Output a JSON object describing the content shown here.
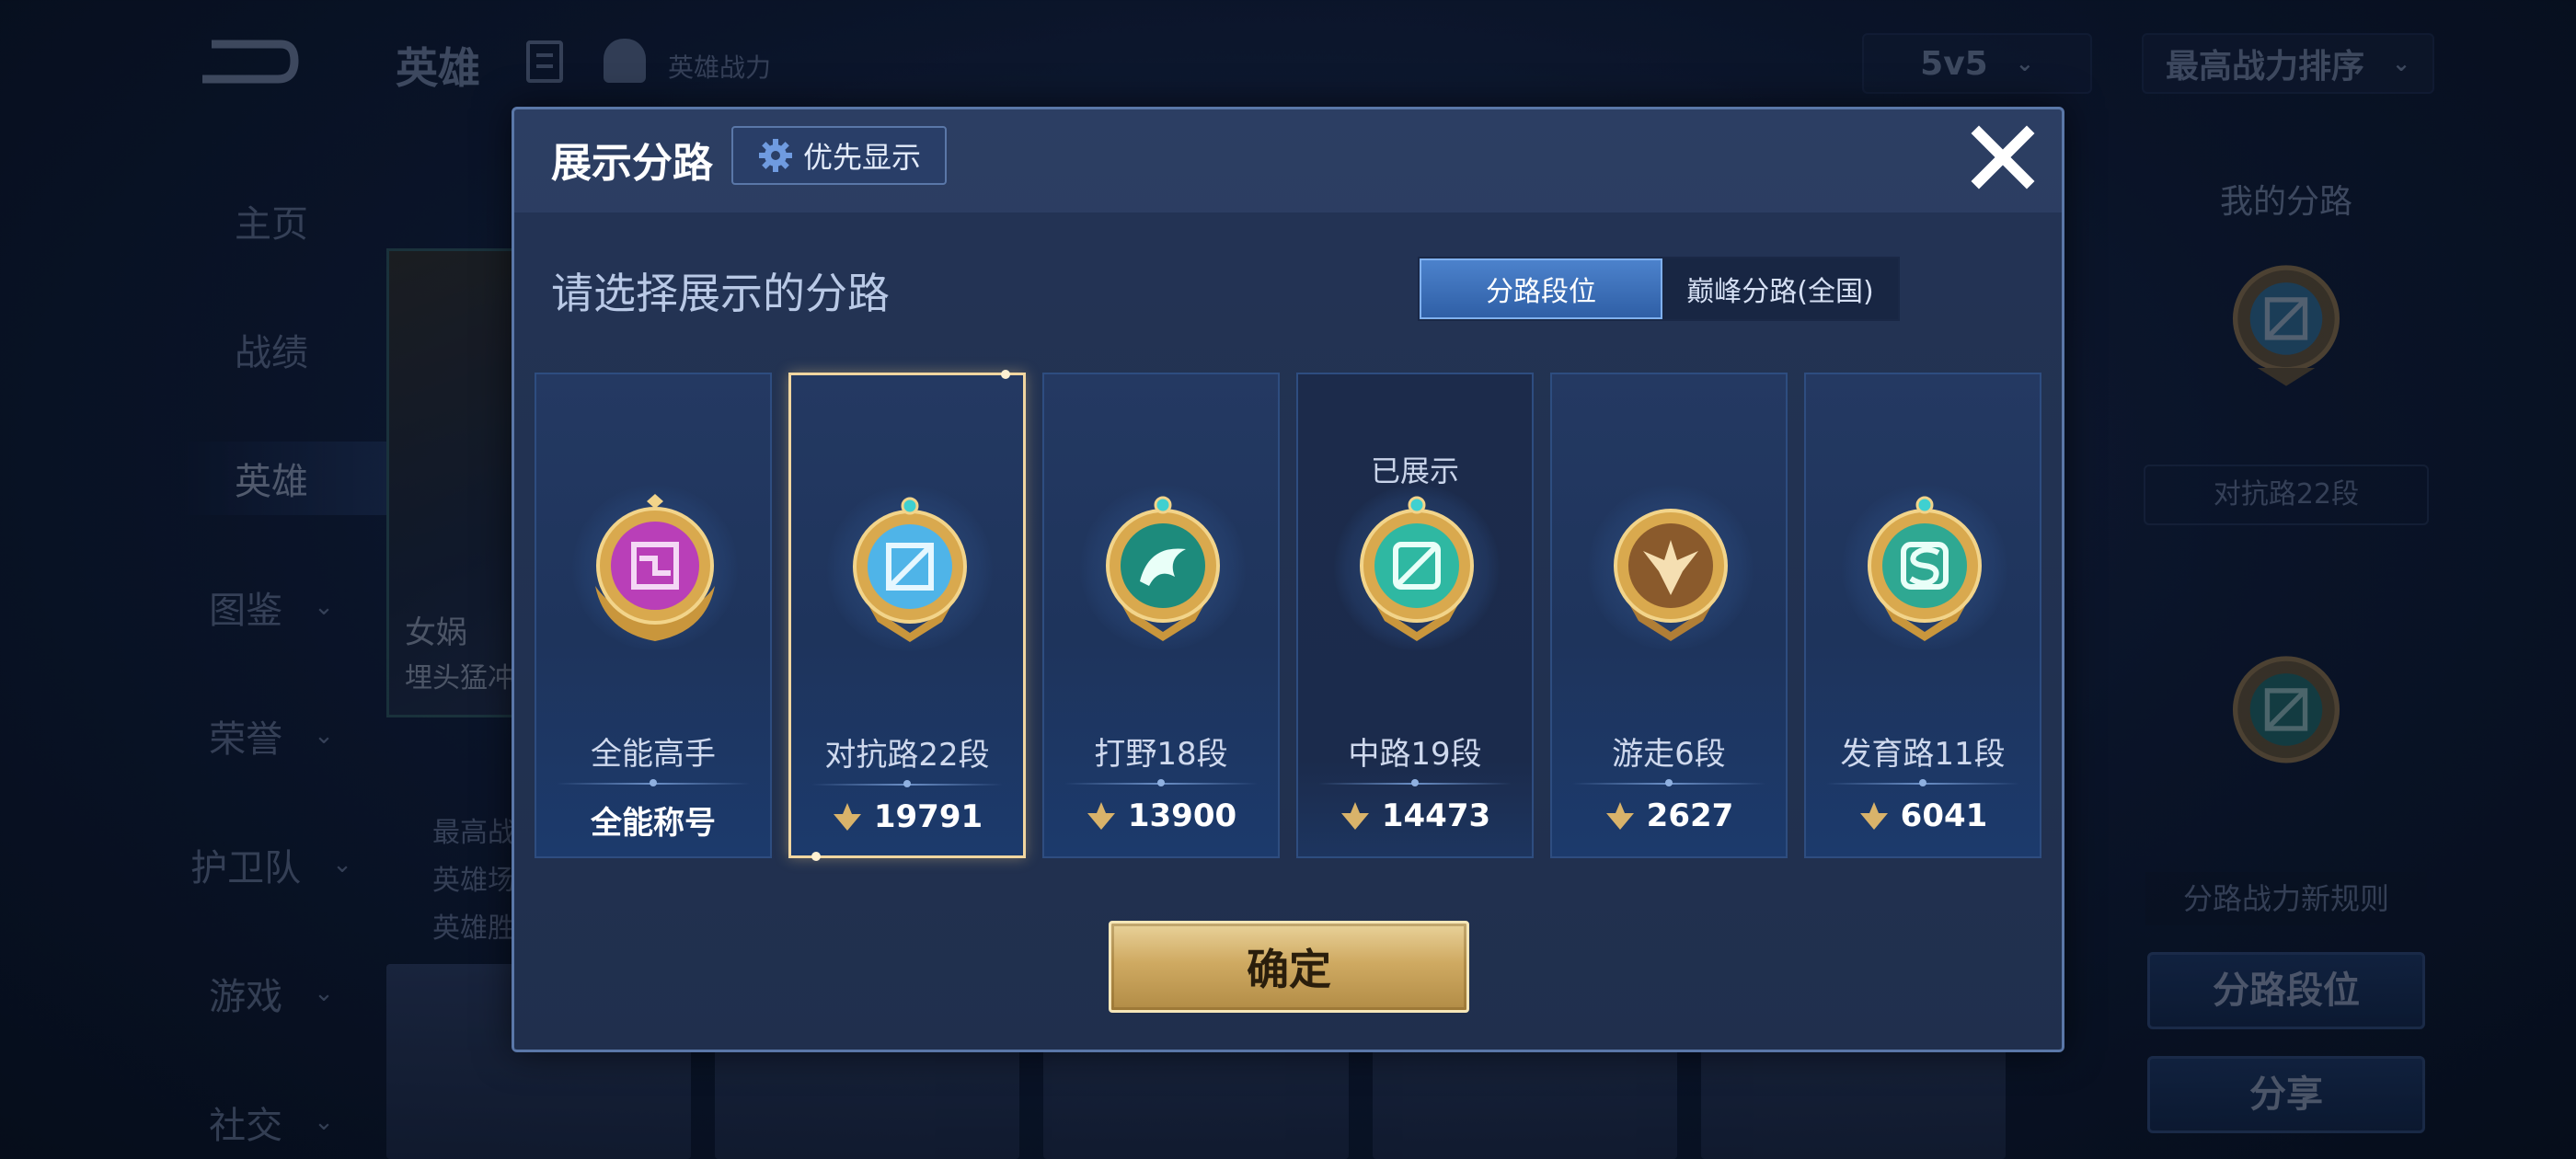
{
  "background": {
    "header": {
      "title": "英雄",
      "subtitle": "英雄战力",
      "mode_select": "5v5",
      "sort_select": "最高战力排序"
    },
    "sidebar": {
      "items": [
        {
          "label": "主页",
          "has_chevron": false,
          "active": false
        },
        {
          "label": "战绩",
          "has_chevron": false,
          "active": false
        },
        {
          "label": "英雄",
          "has_chevron": false,
          "active": true
        },
        {
          "label": "图鉴",
          "has_chevron": true,
          "active": false
        },
        {
          "label": "荣誉",
          "has_chevron": true,
          "active": false
        },
        {
          "label": "护卫队",
          "has_chevron": true,
          "active": false
        },
        {
          "label": "游戏",
          "has_chevron": true,
          "active": false
        },
        {
          "label": "社交",
          "has_chevron": true,
          "active": false
        }
      ]
    },
    "hero_card": {
      "name": "女娲",
      "epithet": "埋头猛冲",
      "stats": [
        "最高战",
        "英雄场",
        "英雄胜"
      ]
    },
    "right_panel": {
      "title": "我的分路",
      "rank": "对抗路22段",
      "rule_label": "分路战力新规则",
      "lane_rank_button": "分路段位",
      "share_button": "分享"
    }
  },
  "dialog": {
    "title": "展示分路",
    "priority_button": "优先显示",
    "subtitle": "请选择展示的分路",
    "tabs": [
      {
        "label": "分路段位",
        "active": true
      },
      {
        "label": "巅峰分路(全国)",
        "active": false
      }
    ],
    "lanes": [
      {
        "id": "all",
        "rank": "全能高手",
        "footer_label": "全能称号",
        "power": null,
        "shown": false,
        "selected": false,
        "medal_color": "#b93fb8",
        "icon": "all-round-medal-icon"
      },
      {
        "id": "clash",
        "rank": "对抗路22段",
        "power": "19791",
        "shown": false,
        "selected": true,
        "medal_color": "#4fb4e8",
        "icon": "clash-lane-medal-icon"
      },
      {
        "id": "jungle",
        "rank": "打野18段",
        "power": "13900",
        "shown": false,
        "selected": false,
        "medal_color": "#1d8b7c",
        "icon": "jungle-medal-icon"
      },
      {
        "id": "mid",
        "rank": "中路19段",
        "power": "14473",
        "shown": true,
        "shown_label": "已展示",
        "selected": false,
        "medal_color": "#2fb8a2",
        "icon": "mid-lane-medal-icon"
      },
      {
        "id": "roam",
        "rank": "游走6段",
        "power": "2627",
        "shown": false,
        "selected": false,
        "medal_color": "#8a5a2c",
        "icon": "roam-medal-icon"
      },
      {
        "id": "farm",
        "rank": "发育路11段",
        "power": "6041",
        "shown": false,
        "selected": false,
        "medal_color": "#2fa892",
        "icon": "farm-lane-medal-icon"
      }
    ],
    "confirm_button": "确定",
    "colors": {
      "accent_blue": "#4c82cc",
      "gold": "#cfaa62",
      "selected_border": "#f1d6a0"
    }
  }
}
